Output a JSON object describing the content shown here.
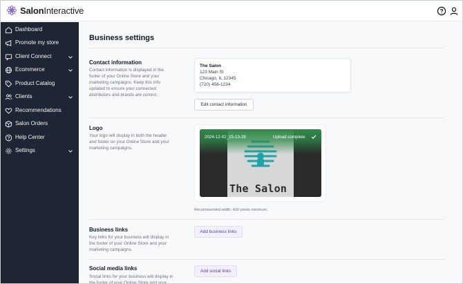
{
  "app": {
    "brand_primary": "Salon",
    "brand_secondary": "Interactive",
    "icons": {
      "logo": "flower-logo-icon",
      "help": "help-circle-icon",
      "user": "user-icon"
    }
  },
  "sidebar": {
    "background": "#1e2533",
    "items": [
      {
        "label": "Dashboard",
        "icon": "home-icon",
        "expandable": false
      },
      {
        "label": "Promote my store",
        "icon": "megaphone-icon",
        "expandable": false
      },
      {
        "label": "Client Connect",
        "icon": "message-icon",
        "expandable": true
      },
      {
        "label": "Ecommerce",
        "icon": "globe-icon",
        "expandable": true
      },
      {
        "label": "Product Catalog",
        "icon": "tag-icon",
        "expandable": false
      },
      {
        "label": "Clients",
        "icon": "users-icon",
        "expandable": true
      },
      {
        "label": "Recommendations",
        "icon": "heart-icon",
        "expandable": false
      },
      {
        "label": "Salon Orders",
        "icon": "box-icon",
        "expandable": false
      },
      {
        "label": "Help Center",
        "icon": "help-icon",
        "expandable": false
      },
      {
        "label": "Settings",
        "icon": "gear-icon",
        "expandable": true
      }
    ]
  },
  "main": {
    "title": "Business settings",
    "contact": {
      "title": "Contact information",
      "description": "Contact information is displayed in the footer of your Online Store and your marketing campaigns. Keep this info updated to ensure your connected distributors and brands are correct.",
      "name": "The Salon",
      "address1": "123 Main St",
      "address2": "Chicago, IL 12345",
      "phone": "(720) 456-1234",
      "button": "Edit contact information"
    },
    "logo": {
      "title": "Logo",
      "description": "Your logo will display in both the header and footer on your Online Store and your marketing campaigns.",
      "file_name": "2024-12-02_15-13-28",
      "status": "Upload complete",
      "image_text": "The Salon",
      "hint": "Recommended width: 400 pixels minimum.",
      "accent": "#2f8a4a",
      "hive_color": "#1fa3a8"
    },
    "business_links": {
      "title": "Business links",
      "description": "Key links for your business will display in the footer of your Online Store and your marketing campaigns.",
      "button": "Add business links"
    },
    "social_links": {
      "title": "Social media links",
      "description": "Social links for your business will display in the footer of your Online Store and your",
      "button": "Add social links"
    }
  }
}
